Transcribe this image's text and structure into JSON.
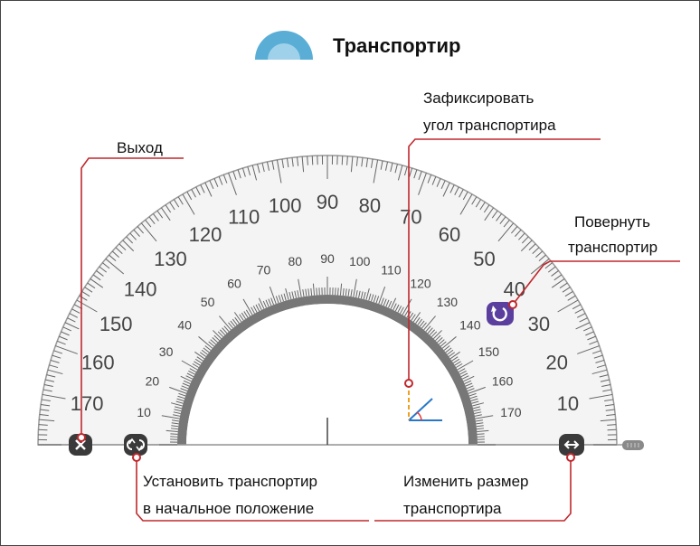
{
  "title": "Транспортир",
  "callouts": {
    "exit": "Выход",
    "fix_angle_line1": "Зафиксировать",
    "fix_angle_line2": "угол транспортира",
    "rotate_line1": "Повернуть",
    "rotate_line2": "транспортир",
    "reset_line1": "Установить транспортир",
    "reset_line2": "в начальное положение",
    "resize_line1": "Изменить размер",
    "resize_line2": "транспортира"
  },
  "icons": {
    "title_icon": "protractor-icon",
    "exit": "close-icon",
    "reset": "reset-icon",
    "rotate": "rotate-icon",
    "resize": "resize-horizontal-icon",
    "handle": "slider-handle-icon",
    "angle_lock": "angle-icon"
  },
  "protractor": {
    "outer_labels": [
      "10",
      "20",
      "30",
      "40",
      "50",
      "60",
      "70",
      "80",
      "90",
      "100",
      "110",
      "120",
      "130",
      "140",
      "150",
      "160",
      "170"
    ],
    "inner_labels": [
      "10",
      "20",
      "30",
      "40",
      "50",
      "60",
      "70",
      "80",
      "90",
      "100",
      "110",
      "120",
      "130",
      "140",
      "150",
      "160",
      "170"
    ]
  },
  "colors": {
    "callout_line": "#c0282d",
    "icon_dark": "#3a3a3a",
    "rotate_button": "#5b3f9e",
    "title_icon": "#5aaed6",
    "angle_lock_line": "#2878c8",
    "angle_lock_dash": "#f0a020"
  }
}
